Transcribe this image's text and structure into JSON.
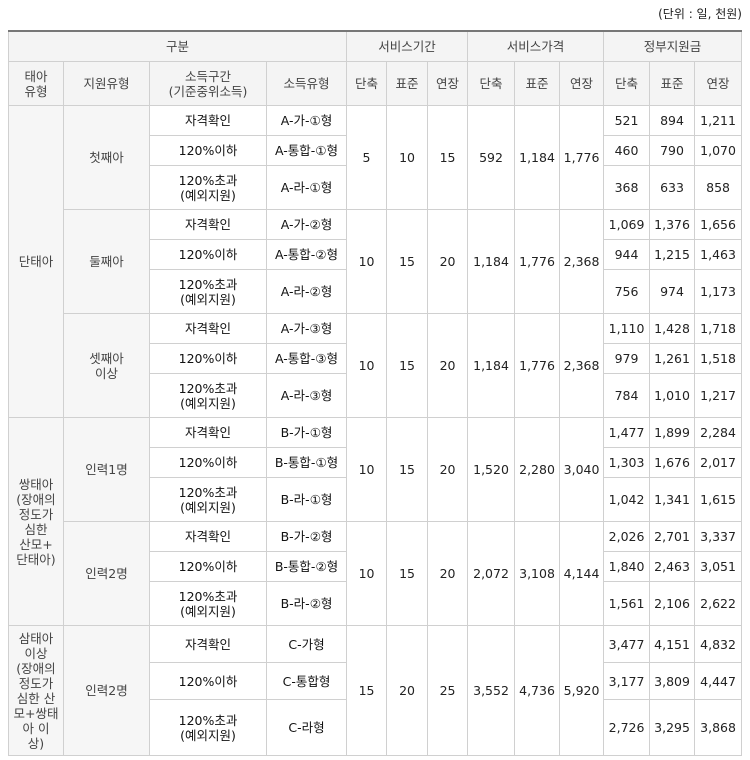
{
  "unit_note": "(단위 : 일, 천원)",
  "header": {
    "group_col": "구분",
    "period": "서비스기간",
    "price": "서비스가격",
    "support": "정부지원금",
    "infant_type": "태아\n유형",
    "support_type": "지원유형",
    "income_range": "소득구간\n(기준중위소득)",
    "income_type": "소득유형",
    "short": "단축",
    "standard": "표준",
    "extend": "연장"
  },
  "blocks": [
    {
      "infant_type": "단태아",
      "groups": [
        {
          "support_type": "첫째아",
          "period": [
            "5",
            "10",
            "15"
          ],
          "price": [
            "592",
            "1,184",
            "1,776"
          ],
          "rows": [
            {
              "income": "자격확인",
              "type": "A-가-①형",
              "support": [
                "521",
                "894",
                "1,211"
              ]
            },
            {
              "income": "120%이하",
              "type": "A-통합-①형",
              "support": [
                "460",
                "790",
                "1,070"
              ]
            },
            {
              "income": "120%초과\n(예외지원)",
              "type": "A-라-①형",
              "support": [
                "368",
                "633",
                "858"
              ]
            }
          ]
        },
        {
          "support_type": "둘째아",
          "period": [
            "10",
            "15",
            "20"
          ],
          "price": [
            "1,184",
            "1,776",
            "2,368"
          ],
          "rows": [
            {
              "income": "자격확인",
              "type": "A-가-②형",
              "support": [
                "1,069",
                "1,376",
                "1,656"
              ]
            },
            {
              "income": "120%이하",
              "type": "A-통합-②형",
              "support": [
                "944",
                "1,215",
                "1,463"
              ]
            },
            {
              "income": "120%초과\n(예외지원)",
              "type": "A-라-②형",
              "support": [
                "756",
                "974",
                "1,173"
              ]
            }
          ]
        },
        {
          "support_type": "셋째아\n이상",
          "period": [
            "10",
            "15",
            "20"
          ],
          "price": [
            "1,184",
            "1,776",
            "2,368"
          ],
          "rows": [
            {
              "income": "자격확인",
              "type": "A-가-③형",
              "support": [
                "1,110",
                "1,428",
                "1,718"
              ]
            },
            {
              "income": "120%이하",
              "type": "A-통합-③형",
              "support": [
                "979",
                "1,261",
                "1,518"
              ]
            },
            {
              "income": "120%초과\n(예외지원)",
              "type": "A-라-③형",
              "support": [
                "784",
                "1,010",
                "1,217"
              ]
            }
          ]
        }
      ]
    },
    {
      "infant_type": "쌍태아\n(장애의\n정도가\n심한\n산모+\n단태아)",
      "groups": [
        {
          "support_type": "인력1명",
          "period": [
            "10",
            "15",
            "20"
          ],
          "price": [
            "1,520",
            "2,280",
            "3,040"
          ],
          "rows": [
            {
              "income": "자격확인",
              "type": "B-가-①형",
              "support": [
                "1,477",
                "1,899",
                "2,284"
              ]
            },
            {
              "income": "120%이하",
              "type": "B-통합-①형",
              "support": [
                "1,303",
                "1,676",
                "2,017"
              ]
            },
            {
              "income": "120%초과\n(예외지원)",
              "type": "B-라-①형",
              "support": [
                "1,042",
                "1,341",
                "1,615"
              ]
            }
          ]
        },
        {
          "support_type": "인력2명",
          "period": [
            "10",
            "15",
            "20"
          ],
          "price": [
            "2,072",
            "3,108",
            "4,144"
          ],
          "rows": [
            {
              "income": "자격확인",
              "type": "B-가-②형",
              "support": [
                "2,026",
                "2,701",
                "3,337"
              ]
            },
            {
              "income": "120%이하",
              "type": "B-통합-②형",
              "support": [
                "1,840",
                "2,463",
                "3,051"
              ]
            },
            {
              "income": "120%초과\n(예외지원)",
              "type": "B-라-②형",
              "support": [
                "1,561",
                "2,106",
                "2,622"
              ]
            }
          ]
        }
      ]
    },
    {
      "infant_type": "삼태아\n이상\n(장애의\n정도가\n심한 산\n모+쌍태\n아 이\n상)",
      "groups": [
        {
          "support_type": "인력2명",
          "period": [
            "15",
            "20",
            "25"
          ],
          "price": [
            "3,552",
            "4,736",
            "5,920"
          ],
          "rows": [
            {
              "income": "자격확인",
              "type": "C-가형",
              "support": [
                "3,477",
                "4,151",
                "4,832"
              ]
            },
            {
              "income": "120%이하",
              "type": "C-통합형",
              "support": [
                "3,177",
                "3,809",
                "4,447"
              ]
            },
            {
              "income": "120%초과\n(예외지원)",
              "type": "C-라형",
              "support": [
                "2,726",
                "3,295",
                "3,868"
              ]
            }
          ]
        }
      ]
    }
  ]
}
